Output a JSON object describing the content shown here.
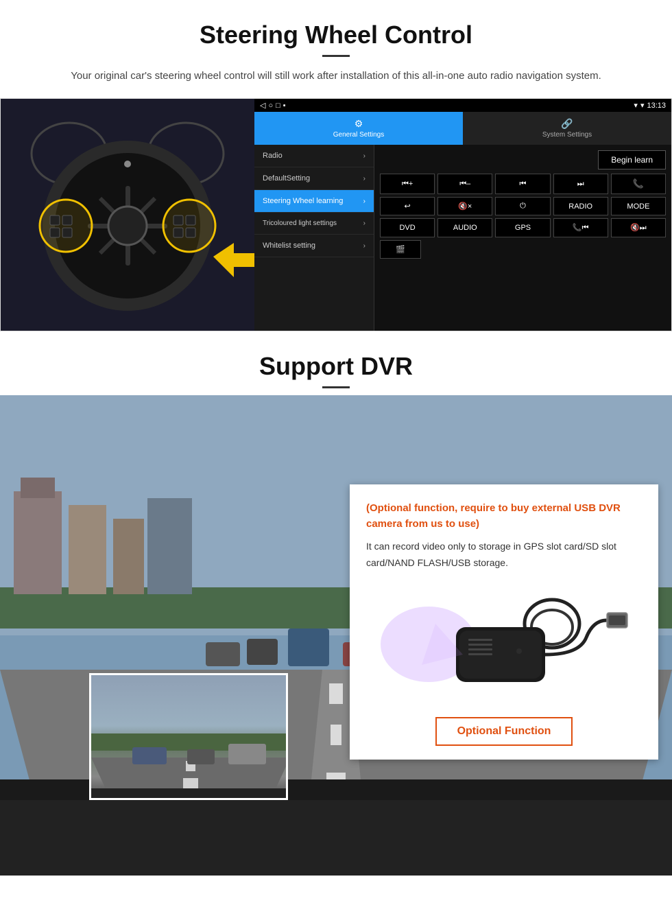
{
  "steering": {
    "title": "Steering Wheel Control",
    "subtitle": "Your original car's steering wheel control will still work after installation of this all-in-one auto radio navigation system.",
    "statusbar": {
      "time": "13:13",
      "signal_icon": "▼",
      "wifi_icon": "▾"
    },
    "tabs": {
      "general": {
        "icon": "⚙",
        "label": "General Settings"
      },
      "system": {
        "icon": "🔗",
        "label": "System Settings"
      }
    },
    "menu_items": [
      {
        "label": "Radio",
        "active": false
      },
      {
        "label": "DefaultSetting",
        "active": false
      },
      {
        "label": "Steering Wheel learning",
        "active": true
      },
      {
        "label": "Tricoloured light settings",
        "active": false
      },
      {
        "label": "Whitelist setting",
        "active": false
      }
    ],
    "begin_learn": "Begin learn",
    "control_buttons_row1": [
      "⏮+",
      "⏮—",
      "⏮⏮",
      "⏭⏭",
      "📞"
    ],
    "control_buttons_row2": [
      "↩",
      "🔇x",
      "⏻",
      "RADIO",
      "MODE"
    ],
    "control_buttons_row3": [
      "DVD",
      "AUDIO",
      "GPS",
      "📞⏮",
      "🔇⏭"
    ],
    "control_buttons_row4": [
      "🎬"
    ]
  },
  "dvr": {
    "title": "Support DVR",
    "optional_text": "(Optional function, require to buy external USB DVR camera from us to use)",
    "description": "It can record video only to storage in GPS slot card/SD slot card/NAND FLASH/USB storage.",
    "optional_button": "Optional Function"
  }
}
